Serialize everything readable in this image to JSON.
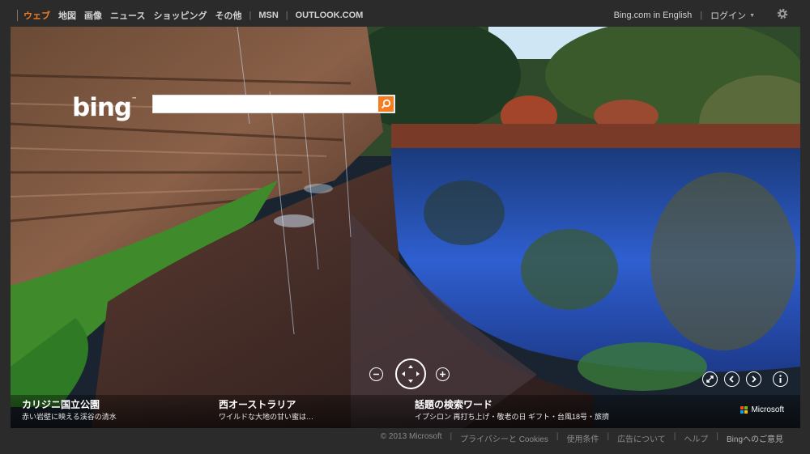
{
  "nav": {
    "items": [
      {
        "label": "ウェブ",
        "active": true
      },
      {
        "label": "地図"
      },
      {
        "label": "画像"
      },
      {
        "label": "ニュース"
      },
      {
        "label": "ショッピング"
      },
      {
        "label": "その他"
      }
    ],
    "msn": "MSN",
    "outlook": "OUTLOOK.COM",
    "english": "Bing.com in English",
    "login": "ログイン"
  },
  "search": {
    "logo": "bing",
    "placeholder": ""
  },
  "captions": [
    {
      "title": "カリジニ国立公園",
      "sub": "赤い岩壁に映える渓谷の清水"
    },
    {
      "title": "西オーストラリア",
      "sub": "ワイルドな大地の甘い蜜は…"
    },
    {
      "title": "話題の検索ワード",
      "sub": "イプシロン 再打ち上げ・敬老の日 ギフト・台風18号・旅擠"
    }
  ],
  "brand": "Microsoft",
  "footer": {
    "copyright": "© 2013 Microsoft",
    "links": [
      "プライバシーと Cookies",
      "使用条件",
      "広告について",
      "ヘルプ"
    ],
    "feedback": "Bingへのご意見"
  },
  "colors": {
    "accent": "#f47c21",
    "bar": "#2b2b2b"
  },
  "icons": [
    "gear-icon",
    "search-icon",
    "zoom-out-icon",
    "pan-icon",
    "zoom-in-icon",
    "fullscreen-icon",
    "previous-icon",
    "next-icon",
    "info-icon"
  ]
}
